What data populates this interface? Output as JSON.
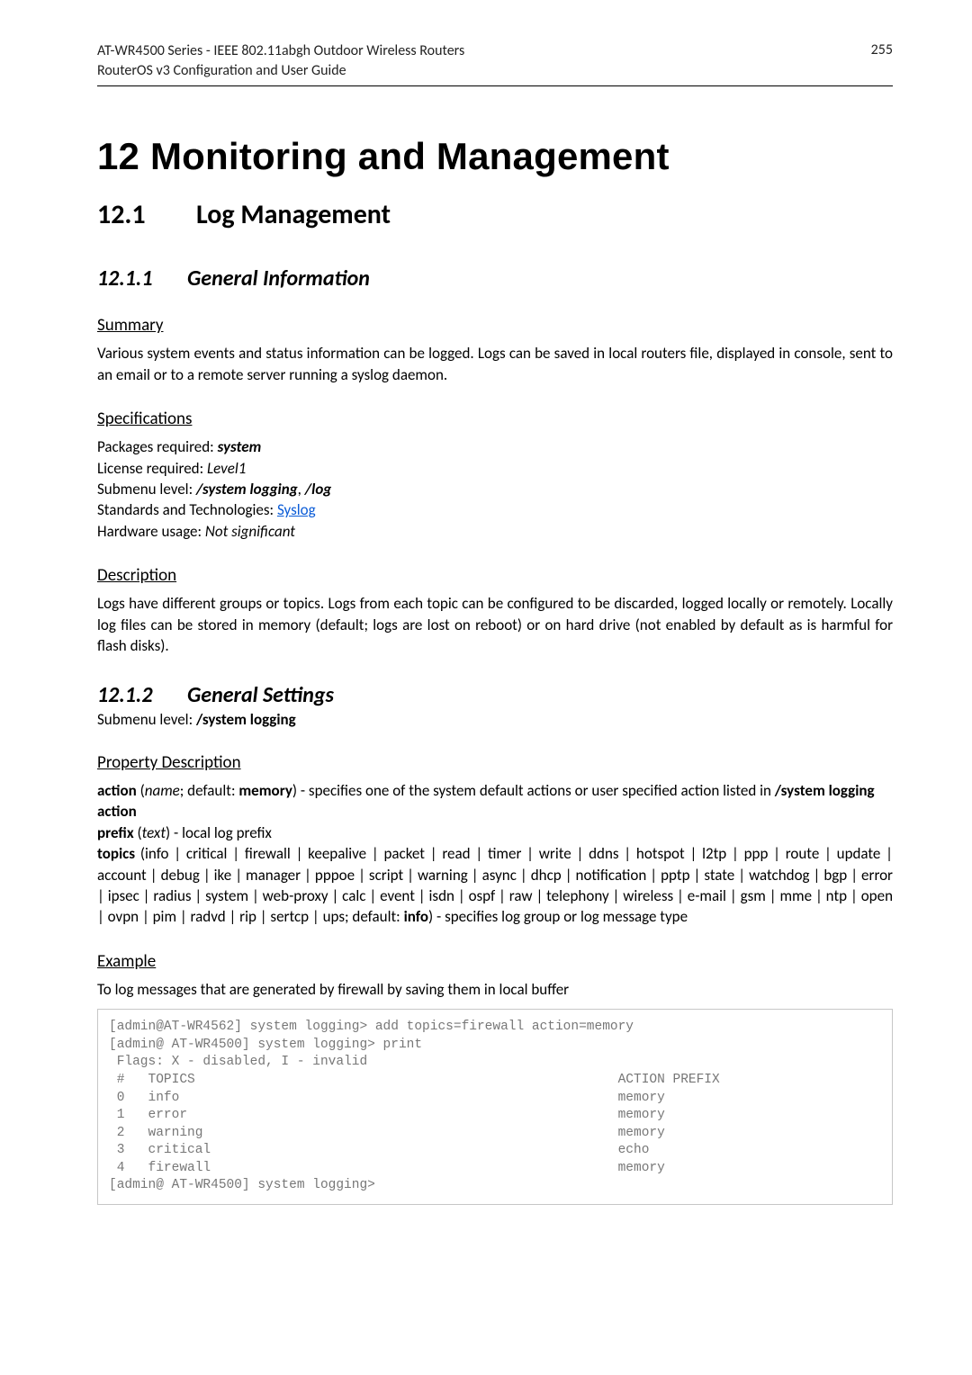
{
  "header": {
    "line1": "AT-WR4500 Series - IEEE 802.11abgh Outdoor Wireless Routers",
    "line2": "RouterOS v3 Configuration and User Guide",
    "pageno": "255"
  },
  "chapter": {
    "title": "12 Monitoring and Management"
  },
  "sec_12_1": {
    "num": "12.1",
    "title": "Log Management"
  },
  "sub_12_1_1": {
    "num": "12.1.1",
    "title": "General Information"
  },
  "summary": {
    "heading": "Summary",
    "text": "Various system events and status information can be logged. Logs can be saved in local routers file, displayed in console, sent to an email or to a remote server running a syslog daemon."
  },
  "specs": {
    "heading": "Specifications",
    "l1a": "Packages required: ",
    "l1b": "system",
    "l2a": "License required: ",
    "l2b": "Level1",
    "l3a": "Submenu level: ",
    "l3b": "/system logging",
    "l3c": ", ",
    "l3d": "/log",
    "l4a": "Standards and Technologies: ",
    "l4link": "Syslog",
    "l5a": "Hardware usage: ",
    "l5b": "Not significant"
  },
  "description": {
    "heading": "Description",
    "text": "Logs have different groups or topics. Logs from each topic can be configured to be discarded, logged locally or remotely. Locally log files can be stored in memory (default; logs are lost on reboot) or on hard drive (not enabled by default as is harmful for flash disks)."
  },
  "sub_12_1_2": {
    "num": "12.1.2",
    "title": "General Settings"
  },
  "submenu_line": {
    "a": "Submenu level: ",
    "b": "/system logging"
  },
  "propdesc": {
    "heading": "Property Description",
    "p1a": "action",
    "p1b": " (",
    "p1c": "name",
    "p1d": "; default: ",
    "p1e": "memory",
    "p1f": ") - specifies one of the system default actions or user specified action listed in ",
    "p1g": "/system logging action",
    "p2a": "prefix",
    "p2b": " (",
    "p2c": "text",
    "p2d": ") - local log prefix",
    "p3a": "topics",
    "p3b": " (info | critical | firewall | keepalive | packet | read | timer | write | ddns | hotspot | l2tp | ppp | route | update | account | debug | ike | manager | pppoe | script | warning | async | dhcp | notification | pptp | state | watchdog | bgp | error | ipsec | radius | system | web-proxy | calc | event | isdn | ospf | raw | telephony | wireless | e-mail | gsm | mme | ntp | open | ovpn | pim | radvd | rip | sertcp | ups; default: ",
    "p3c": "info",
    "p3d": ") - specifies log group or log message type"
  },
  "example": {
    "heading": "Example",
    "intro": "To log messages that are generated by firewall by saving them in local buffer",
    "code": "[admin@AT-WR4562] system logging> add topics=firewall action=memory\n[admin@ AT-WR4500] system logging> print\n Flags: X - disabled, I - invalid\n #   TOPICS                                                      ACTION PREFIX\n 0   info                                                        memory\n 1   error                                                       memory\n 2   warning                                                     memory\n 3   critical                                                    echo\n 4   firewall                                                    memory\n[admin@ AT-WR4500] system logging>"
  }
}
